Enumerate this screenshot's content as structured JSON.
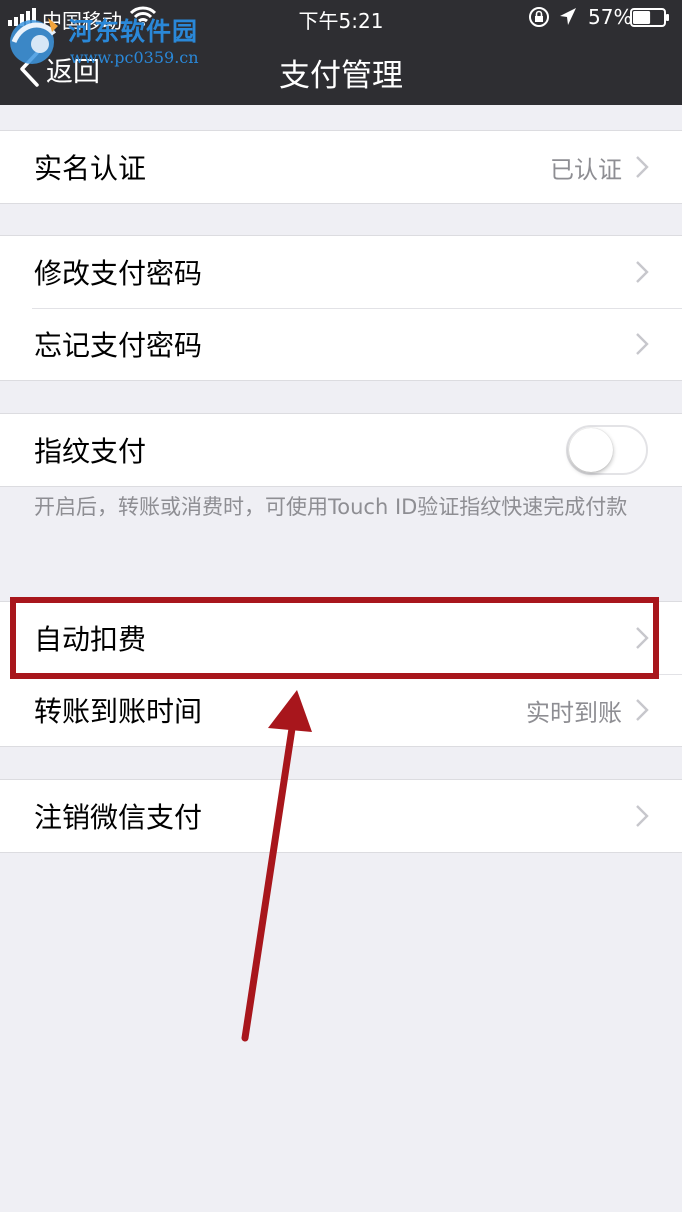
{
  "status_bar": {
    "carrier": "中国移动",
    "time": "下午5:21",
    "battery_percent": "57%",
    "battery_level": 0.57,
    "icons": [
      "signal-icon",
      "wifi-icon",
      "rotation-lock-icon",
      "location-icon",
      "battery-icon"
    ]
  },
  "nav": {
    "back_label": "返回",
    "title": "支付管理"
  },
  "watermark": {
    "name": "河东软件园",
    "url": "www.pc0359.cn"
  },
  "sections": {
    "verify": {
      "label": "实名认证",
      "value": "已认证"
    },
    "change_password": {
      "label": "修改支付密码"
    },
    "forgot_password": {
      "label": "忘记支付密码"
    },
    "fingerprint": {
      "label": "指纹支付",
      "enabled": false,
      "footnote": "开启后，转账或消费时，可使用Touch ID验证指纹快速完成付款"
    },
    "auto_deduct": {
      "label": "自动扣费"
    },
    "transfer_time": {
      "label": "转账到账时间",
      "value": "实时到账"
    },
    "cancel_pay": {
      "label": "注销微信支付"
    }
  },
  "colors": {
    "header_bg": "#2e2e32",
    "page_bg": "#efeff4",
    "annotation": "#a8161c",
    "secondary_text": "#8e8e93"
  }
}
